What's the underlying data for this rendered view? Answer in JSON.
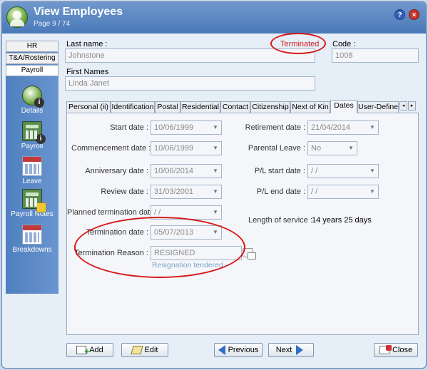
{
  "window": {
    "title": "View Employees",
    "subtitle": "Page 9 / 74",
    "help": "?",
    "close": "×"
  },
  "sidebar": {
    "tabs": [
      "HR",
      "T&A/Rostering",
      "Payroll"
    ],
    "items": [
      {
        "label": "Details",
        "icon": "details-icon"
      },
      {
        "label": "Payroll",
        "icon": "payroll-calculator-icon"
      },
      {
        "label": "Leave",
        "icon": "calendar-icon"
      },
      {
        "label": "Payroll Notes",
        "icon": "payroll-notes-icon"
      },
      {
        "label": "Breakdowns",
        "icon": "breakdowns-icon"
      }
    ]
  },
  "header": {
    "last_name_label": "Last name :",
    "last_name": "Johnstone",
    "status": "Terminated",
    "code_label": "Code :",
    "code": "1008",
    "first_names_label": "First Names",
    "first_names": "Linda Janet"
  },
  "tabs": [
    "Personal (ii)",
    "Identification",
    "Postal",
    "Residential",
    "Contact",
    "Citizenship",
    "Next of Kin",
    "Dates",
    "User-Defined"
  ],
  "tab_scroll": {
    "left": "◂",
    "right": "▸"
  },
  "dates": {
    "start_label": "Start date :",
    "start": "10/06/1999",
    "commencement_label": "Commencement date :",
    "commencement": "10/06/1999",
    "anniversary_label": "Anniversary date :",
    "anniversary": "10/06/2014",
    "review_label": "Review date :",
    "review": "31/03/2001",
    "planned_term_label": "Planned termination date :",
    "planned_term": "/  /",
    "retirement_label": "Retirement date :",
    "retirement": "21/04/2014",
    "parental_leave_label": "Parental Leave :",
    "parental_leave": "No",
    "pl_start_label": "P/L start date :",
    "pl_start": "/  /",
    "pl_end_label": "P/L end date :",
    "pl_end": "/  /",
    "length_label": "Length of service :",
    "length": "14 years 25 days",
    "termination_label": "Termination date :",
    "termination": "05/07/2013",
    "term_reason_label": "Termination Reason :",
    "term_reason": "RESIGNED",
    "term_reason_desc": "Resignation tendered"
  },
  "buttons": {
    "add": "Add",
    "edit": "Edit",
    "previous": "Previous",
    "next": "Next",
    "close": "Close"
  },
  "colors": {
    "status": "#d41d1d",
    "highlight": "#d81818",
    "sidebar": "#5a88c6"
  }
}
